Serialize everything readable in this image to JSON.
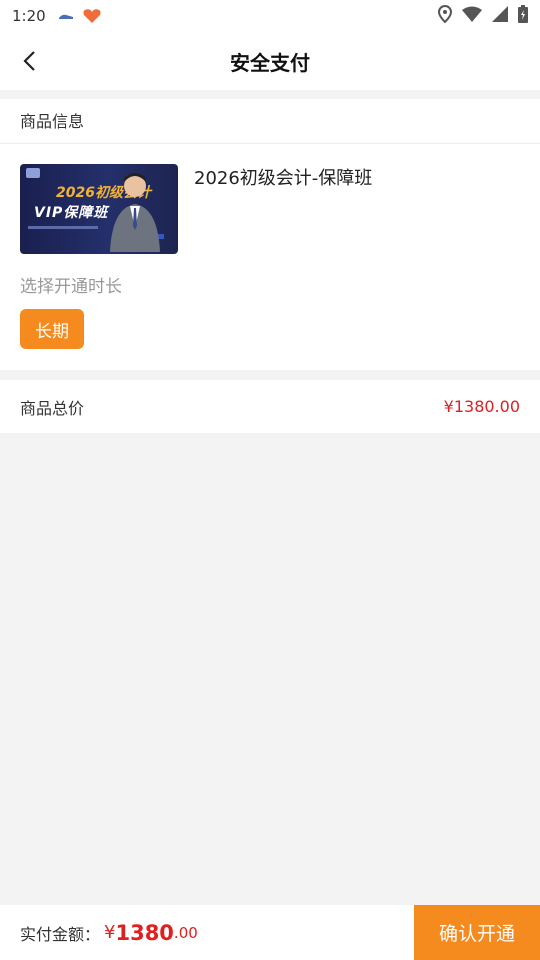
{
  "status_bar": {
    "time": "1:20"
  },
  "header": {
    "title": "安全支付"
  },
  "product": {
    "section_title": "商品信息",
    "name": "2026初级会计-保障班",
    "thumb_year": "2026初级会计",
    "thumb_vip": "VIP保障班",
    "duration_label": "选择开通时长",
    "duration_option": "长期"
  },
  "total": {
    "label": "商品总价",
    "price": "¥1380.00"
  },
  "bottom": {
    "pay_label": "实付金额：",
    "currency": "¥",
    "amount_int": "1380",
    "amount_dec": ".00",
    "confirm_label": "确认开通"
  },
  "colors": {
    "accent": "#f58a1f",
    "price": "#e02020",
    "background": "#f3f3f3"
  }
}
